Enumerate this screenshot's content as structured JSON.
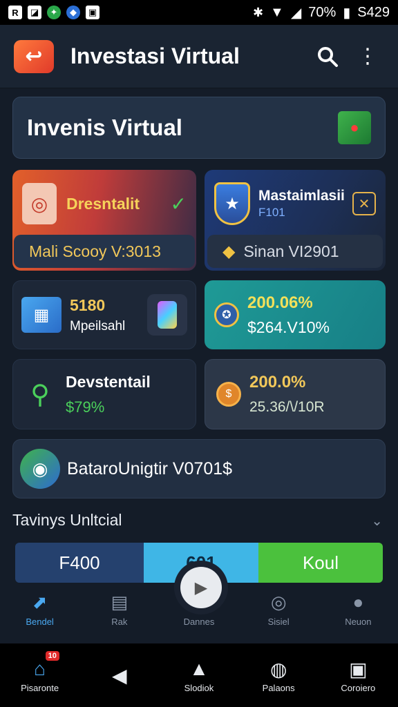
{
  "status": {
    "battery": "70%",
    "time": "S429"
  },
  "header": {
    "title": "Investasi Virtual"
  },
  "banner": {
    "title": "Invenis Virtual"
  },
  "cards": {
    "card1": {
      "title": "Dresntalit",
      "pill": "Mali Scooy V:3013"
    },
    "card2": {
      "title": "Mastaimlasii",
      "sub": "F101",
      "pill": "Sinan VI2901"
    },
    "card3": {
      "value": "5180",
      "label": "Mpeilsahl"
    },
    "card4": {
      "value": "200.06%",
      "sub": "$264.V10%"
    },
    "card5": {
      "title": "Devstentail",
      "value": "$79%"
    },
    "card6": {
      "value": "200.0%",
      "sub": "25.36/\\/10R"
    },
    "wide": {
      "text": "BataroUnigtir V0701$"
    }
  },
  "section": {
    "title": "Tavinys Unltcial"
  },
  "segments": [
    "F400",
    "601",
    "Koul"
  ],
  "tabs": [
    "Bendel",
    "Rak",
    "Dannes",
    "Sisiel",
    "Neuon"
  ],
  "sysnav": {
    "badge": "10",
    "items": [
      "Pisaronte",
      "Slodiok",
      "Palaons",
      "Coroiero"
    ]
  },
  "colors": {
    "accent": "#4aa8f0",
    "green": "#4bd05b",
    "gold": "#f2c85a"
  }
}
